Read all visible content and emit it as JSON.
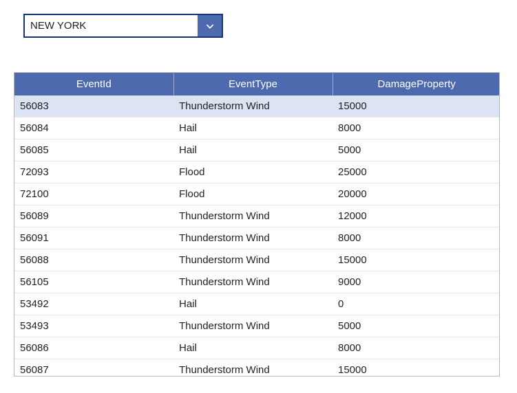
{
  "dropdown": {
    "selected": "NEW YORK"
  },
  "table": {
    "headers": [
      "EventId",
      "EventType",
      "DamageProperty"
    ],
    "rows": [
      {
        "eventId": "56083",
        "eventType": "Thunderstorm Wind",
        "damage": "15000",
        "selected": true
      },
      {
        "eventId": "56084",
        "eventType": "Hail",
        "damage": "8000",
        "selected": false
      },
      {
        "eventId": "56085",
        "eventType": "Hail",
        "damage": "5000",
        "selected": false
      },
      {
        "eventId": "72093",
        "eventType": "Flood",
        "damage": "25000",
        "selected": false
      },
      {
        "eventId": "72100",
        "eventType": "Flood",
        "damage": "20000",
        "selected": false
      },
      {
        "eventId": "56089",
        "eventType": "Thunderstorm Wind",
        "damage": "12000",
        "selected": false
      },
      {
        "eventId": "56091",
        "eventType": "Thunderstorm Wind",
        "damage": "8000",
        "selected": false
      },
      {
        "eventId": "56088",
        "eventType": "Thunderstorm Wind",
        "damage": "15000",
        "selected": false
      },
      {
        "eventId": "56105",
        "eventType": "Thunderstorm Wind",
        "damage": "9000",
        "selected": false
      },
      {
        "eventId": "53492",
        "eventType": "Hail",
        "damage": "0",
        "selected": false
      },
      {
        "eventId": "53493",
        "eventType": "Thunderstorm Wind",
        "damage": "5000",
        "selected": false
      },
      {
        "eventId": "56086",
        "eventType": "Hail",
        "damage": "8000",
        "selected": false
      },
      {
        "eventId": "56087",
        "eventType": "Thunderstorm Wind",
        "damage": "15000",
        "selected": false
      }
    ]
  }
}
